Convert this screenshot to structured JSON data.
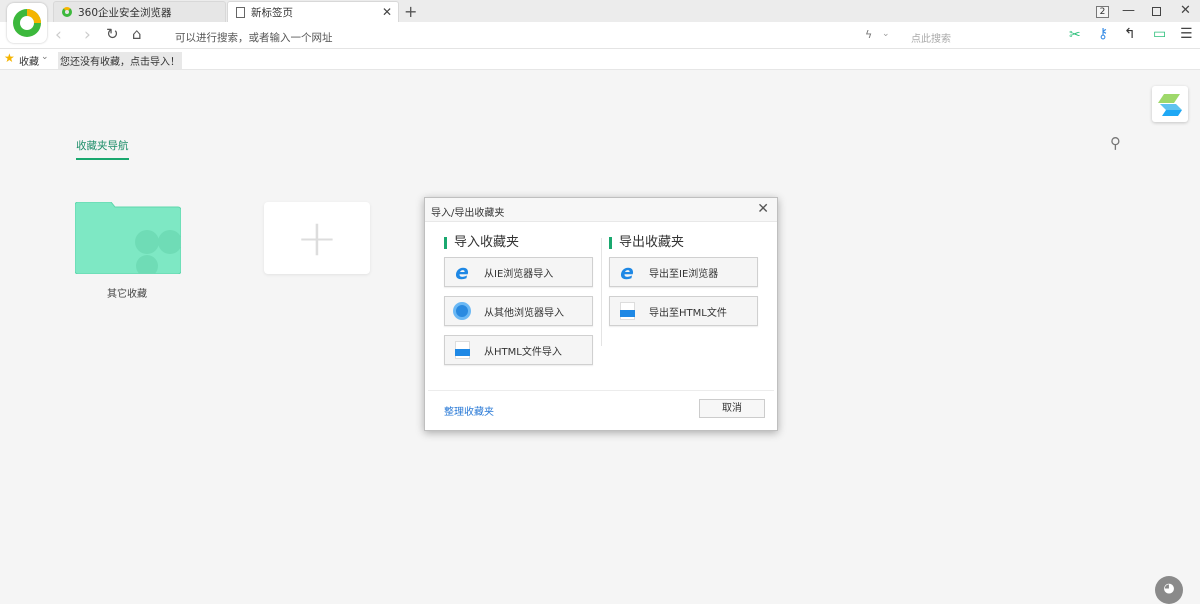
{
  "tabs": [
    {
      "label": "360企业安全浏览器",
      "icon": "browser-logo-icon"
    },
    {
      "label": "新标签页",
      "icon": "page-icon"
    }
  ],
  "window": {
    "tab_count": "2"
  },
  "address": {
    "placeholder": "可以进行搜索，或者输入一个网址"
  },
  "search": {
    "placeholder": "点此搜索"
  },
  "bookmarks": {
    "label": "收藏",
    "empty_hint": "您还没有收藏，点击导入！"
  },
  "page": {
    "nav_tab": "收藏夹导航",
    "folder_label": "其它收藏"
  },
  "dialog": {
    "title": "导入/导出收藏夹",
    "import_heading": "导入收藏夹",
    "export_heading": "导出收藏夹",
    "import_buttons": [
      {
        "label": "从IE浏览器导入",
        "icon": "ie-icon"
      },
      {
        "label": "从其他浏览器导入",
        "icon": "globe-icon"
      },
      {
        "label": "从HTML文件导入",
        "icon": "html-file-icon"
      }
    ],
    "export_buttons": [
      {
        "label": "导出至IE浏览器",
        "icon": "ie-icon"
      },
      {
        "label": "导出至HTML文件",
        "icon": "html-file-icon"
      }
    ],
    "manage_link": "整理收藏夹",
    "cancel": "取消"
  },
  "colors": {
    "accent": "#1aa86f",
    "folder": "#7ee8c4",
    "link": "#2a7ad6"
  }
}
